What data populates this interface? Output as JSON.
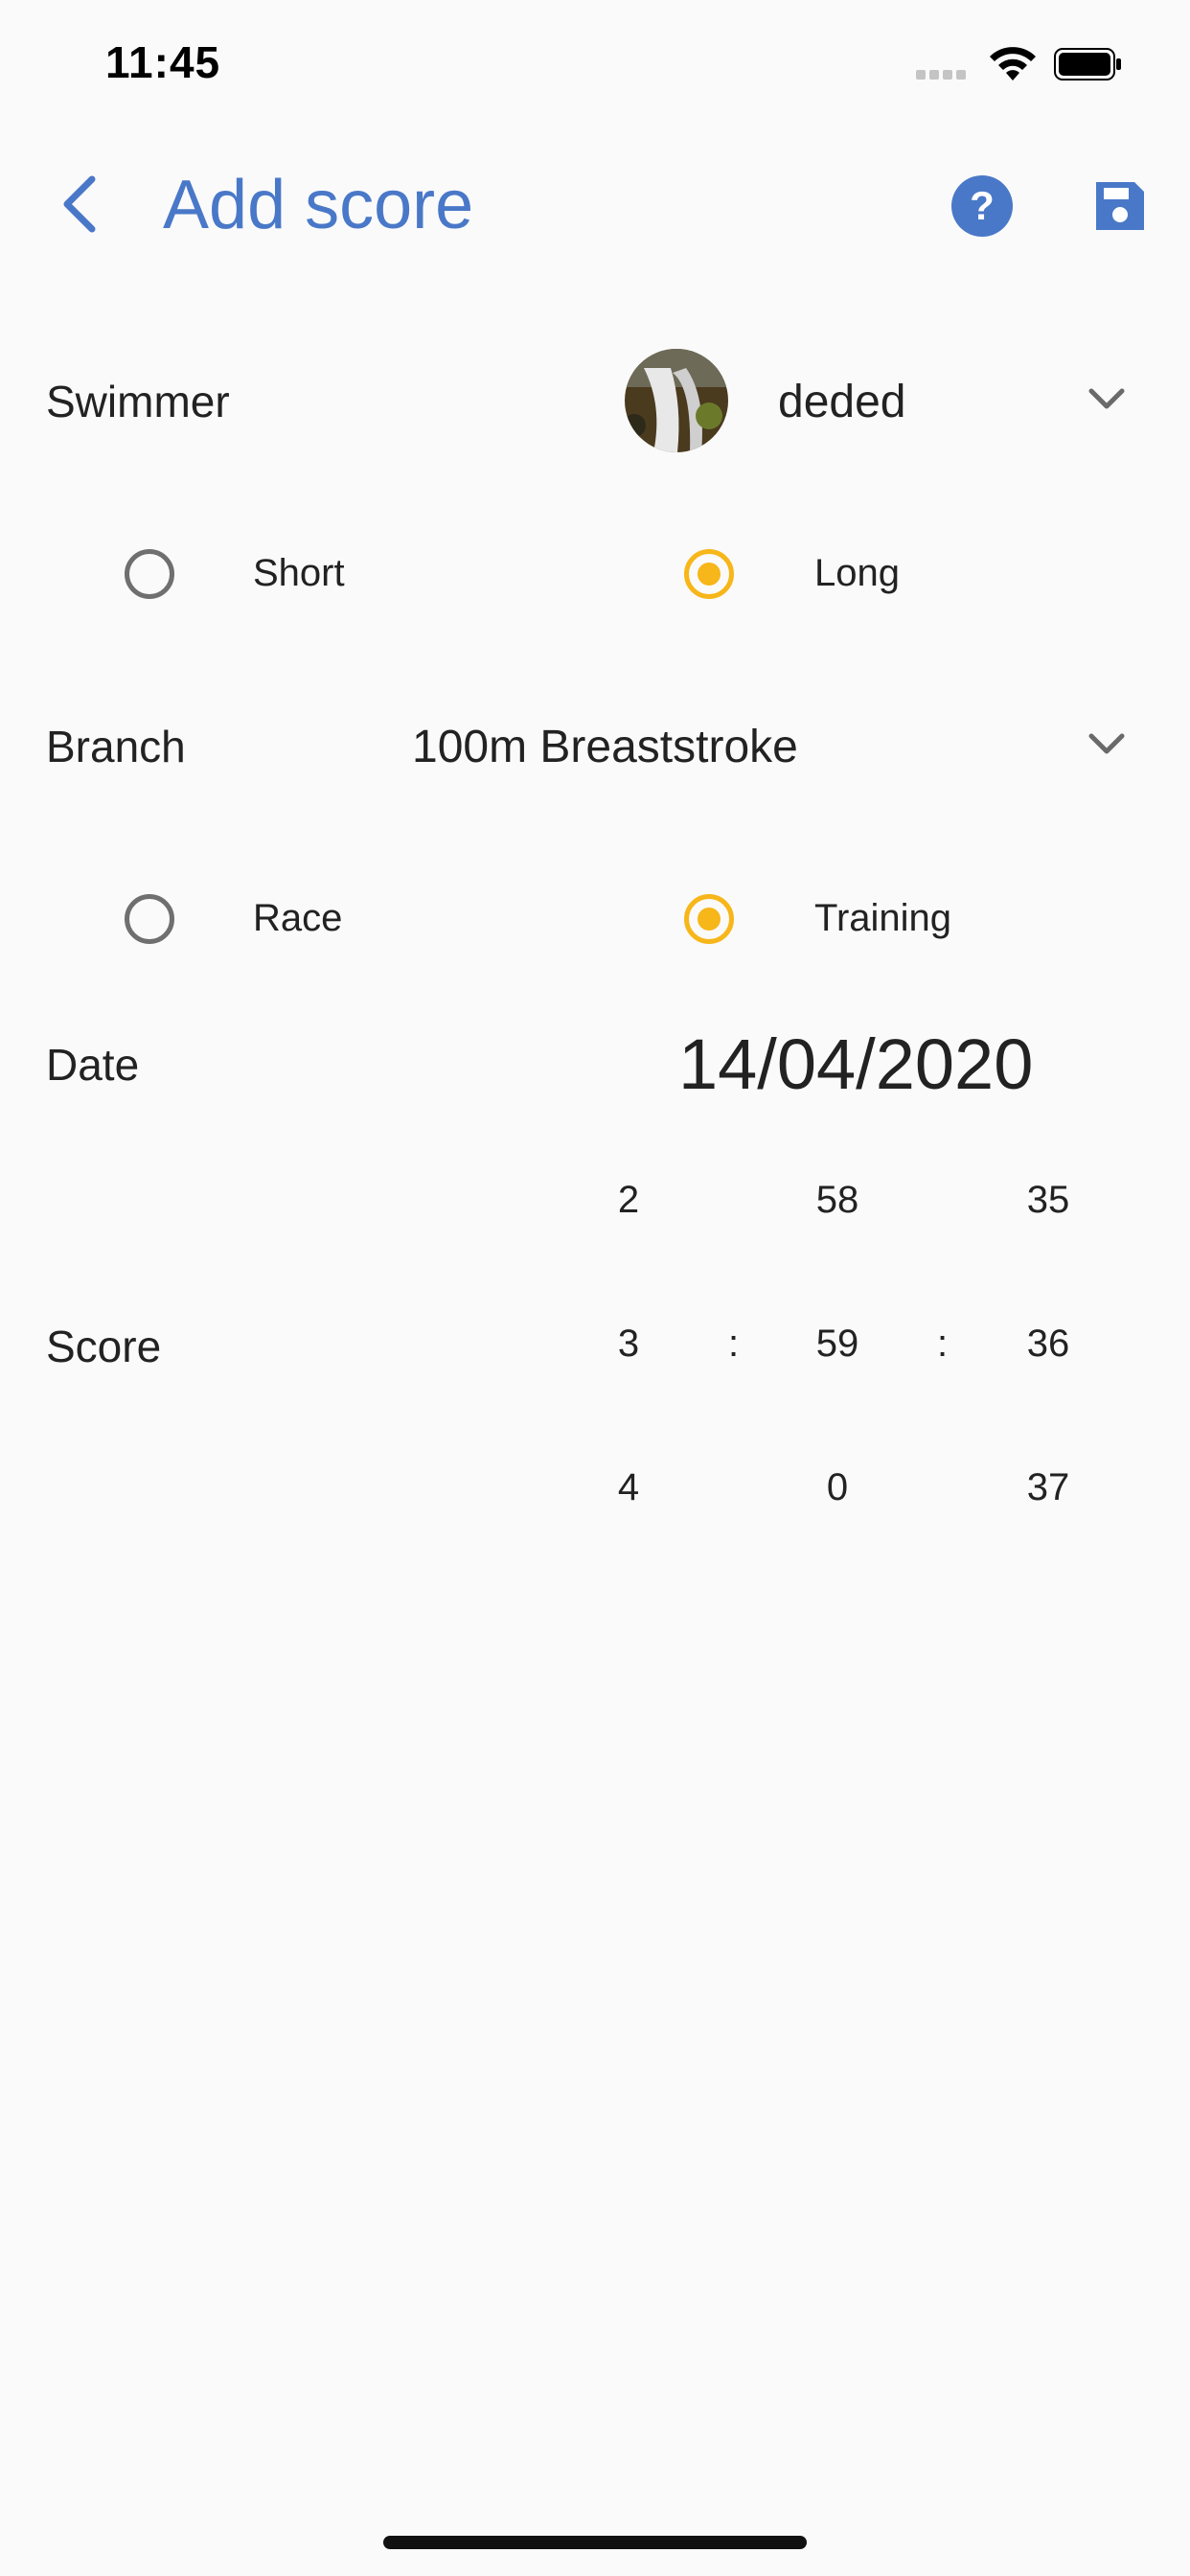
{
  "status_bar": {
    "time": "11:45"
  },
  "app_bar": {
    "title": "Add score"
  },
  "form": {
    "swimmer_label": "Swimmer",
    "swimmer_value": "deded",
    "pool_options": [
      {
        "label": "Short",
        "selected": false
      },
      {
        "label": "Long",
        "selected": true
      }
    ],
    "branch_label": "Branch",
    "branch_value": "100m Breaststroke",
    "type_options": [
      {
        "label": "Race",
        "selected": false
      },
      {
        "label": "Training",
        "selected": true
      }
    ],
    "date_label": "Date",
    "date_value": "14/04/2020",
    "score_label": "Score",
    "score_picker": {
      "separator": ":",
      "columns": [
        [
          "2",
          "3",
          "4"
        ],
        [
          "58",
          "59",
          "0"
        ],
        [
          "35",
          "36",
          "37"
        ]
      ],
      "selected_index": 1
    }
  },
  "colors": {
    "accent": "#4a78c8",
    "radio_selected": "#f7b619",
    "radio_unselected": "#6f6f6f"
  }
}
